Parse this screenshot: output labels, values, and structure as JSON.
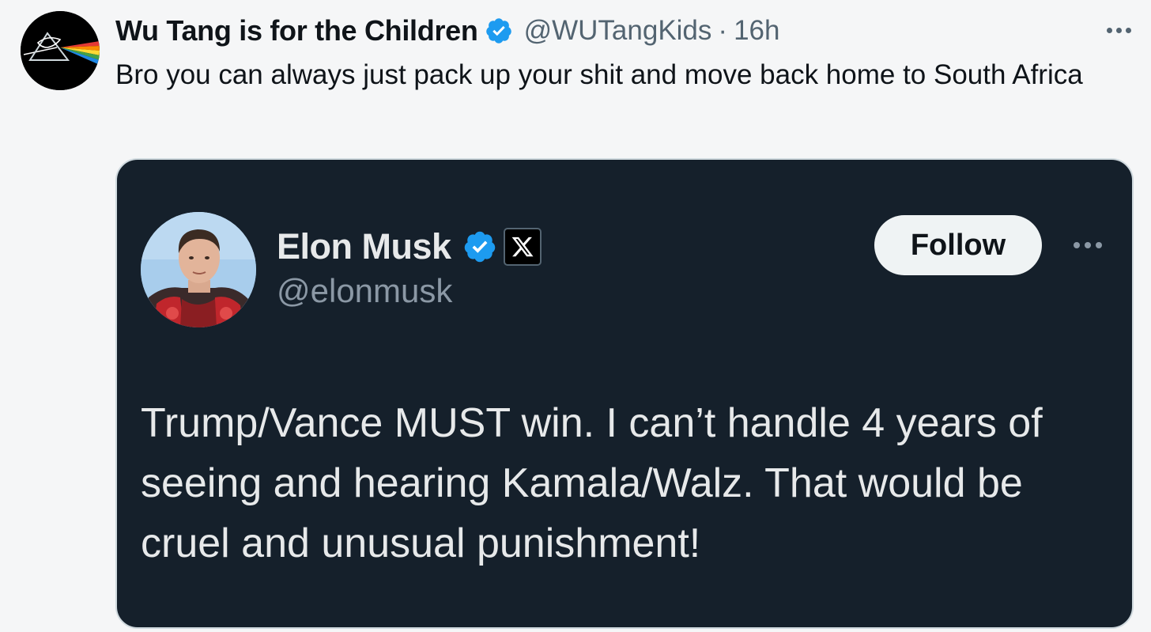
{
  "outer_tweet": {
    "avatar_icon": "wu-tang-prism-logo",
    "display_name": "Wu Tang is for the Children",
    "verified_icon": "verified-badge-icon",
    "handle": "@WUTangKids",
    "separator": "·",
    "time": "16h",
    "more_icon": "more-options-icon",
    "text": "Bro you can always just pack up your shit and move back home to South Africa"
  },
  "quoted_tweet": {
    "avatar_icon": "elon-musk-photo",
    "display_name": "Elon Musk",
    "verified_icon": "verified-badge-icon",
    "affiliate_icon": "x-logo-icon",
    "handle": "@elonmusk",
    "follow_label": "Follow",
    "more_icon": "more-options-icon",
    "text": "Trump/Vance MUST win. I can’t handle 4 years of seeing and hearing Kamala/Walz. That would be cruel and unusual punishment!"
  },
  "colors": {
    "background": "#f5f6f7",
    "card_background": "#15202b",
    "verified_blue": "#1d9bf0",
    "primary_text_light": "#0f1419",
    "secondary_text_light": "#536471",
    "primary_text_dark": "#e7e9ea",
    "secondary_text_dark": "#8b98a5"
  }
}
